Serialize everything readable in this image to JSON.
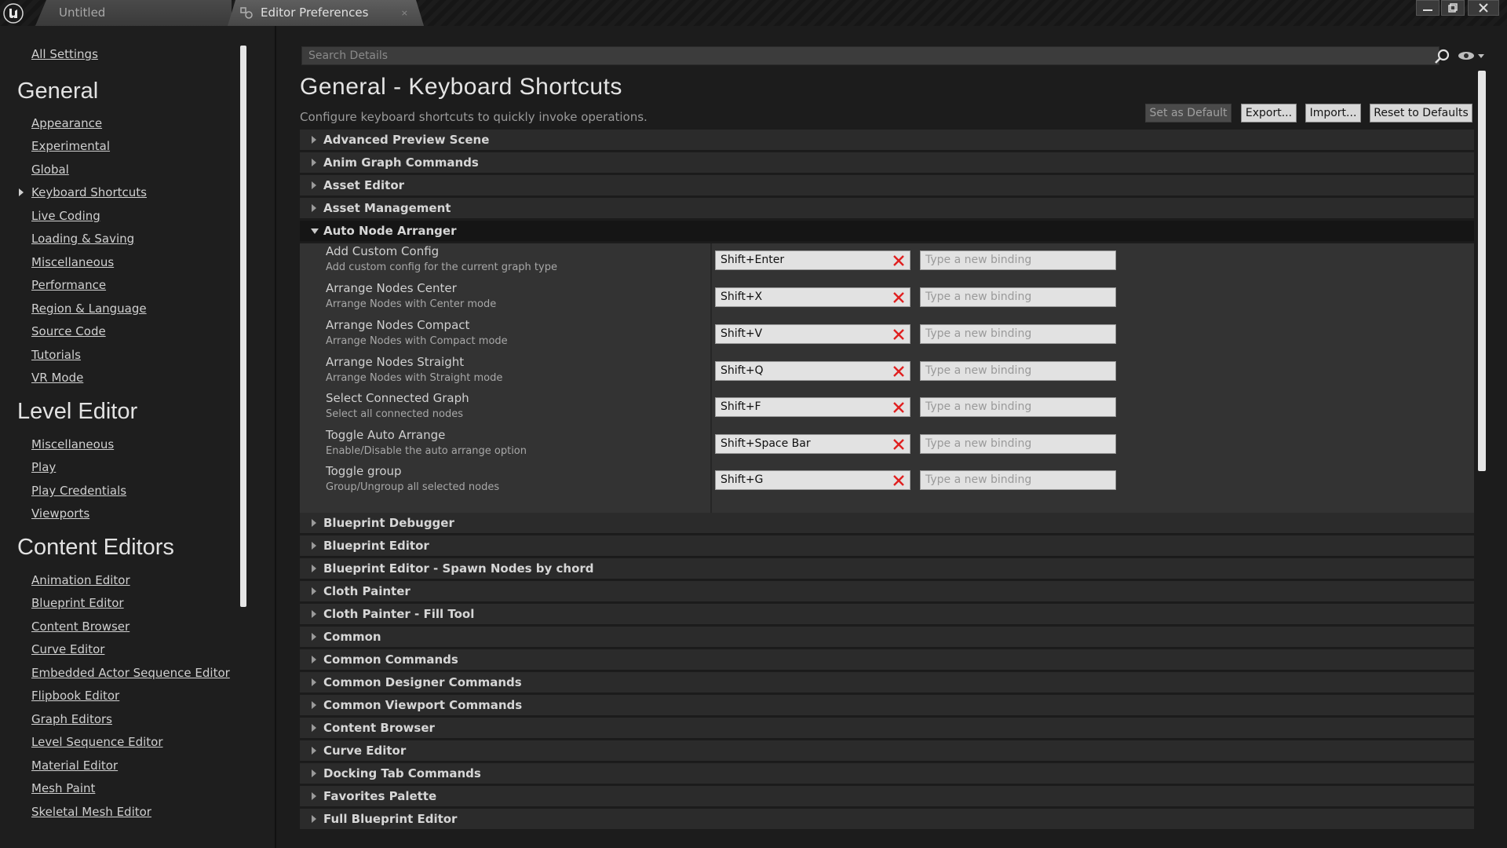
{
  "titlebar": {
    "tabs": [
      {
        "label": "Untitled"
      },
      {
        "label": "Editor Preferences"
      }
    ]
  },
  "sidebar": {
    "all_settings": "All Settings",
    "sections": [
      {
        "heading": "General",
        "items": [
          "Appearance",
          "Experimental",
          "Global",
          "Keyboard Shortcuts",
          "Live Coding",
          "Loading & Saving",
          "Miscellaneous",
          "Performance",
          "Region & Language",
          "Source Code",
          "Tutorials",
          "VR Mode"
        ]
      },
      {
        "heading": "Level Editor",
        "items": [
          "Miscellaneous",
          "Play",
          "Play Credentials",
          "Viewports"
        ]
      },
      {
        "heading": "Content Editors",
        "items": [
          "Animation Editor",
          "Blueprint Editor",
          "Content Browser",
          "Curve Editor",
          "Embedded Actor Sequence Editor",
          "Flipbook Editor",
          "Graph Editors",
          "Level Sequence Editor",
          "Material Editor",
          "Mesh Paint",
          "Skeletal Mesh Editor"
        ]
      }
    ],
    "active_item": "Keyboard Shortcuts"
  },
  "search": {
    "placeholder": "Search Details"
  },
  "page": {
    "title": "General - Keyboard Shortcuts",
    "description": "Configure keyboard shortcuts to quickly invoke operations."
  },
  "buttons": {
    "set_default": "Set as Default",
    "export": "Export...",
    "import": "Import...",
    "reset": "Reset to Defaults"
  },
  "categories_before": [
    "Advanced Preview Scene",
    "Anim Graph Commands",
    "Asset Editor",
    "Asset Management"
  ],
  "expanded_category": "Auto Node Arranger",
  "commands": [
    {
      "name": "Add Custom Config",
      "desc": "Add custom config for the current graph type",
      "binding": "Shift+Enter"
    },
    {
      "name": "Arrange Nodes Center",
      "desc": "Arrange Nodes with Center mode",
      "binding": "Shift+X"
    },
    {
      "name": "Arrange Nodes Compact",
      "desc": "Arrange Nodes with Compact mode",
      "binding": "Shift+V"
    },
    {
      "name": "Arrange Nodes Straight",
      "desc": "Arrange Nodes with Straight mode",
      "binding": "Shift+Q"
    },
    {
      "name": "Select Connected Graph",
      "desc": "Select all connected nodes",
      "binding": "Shift+F"
    },
    {
      "name": "Toggle Auto Arrange",
      "desc": "Enable/Disable the auto arrange option",
      "binding": "Shift+Space Bar"
    },
    {
      "name": "Toggle group",
      "desc": "Group/Ungroup all selected nodes",
      "binding": "Shift+G"
    }
  ],
  "new_binding_placeholder": "Type a new binding",
  "categories_after": [
    "Blueprint Debugger",
    "Blueprint Editor",
    "Blueprint Editor - Spawn Nodes by chord",
    "Cloth Painter",
    "Cloth Painter - Fill Tool",
    "Common",
    "Common Commands",
    "Common Designer Commands",
    "Common Viewport Commands",
    "Content Browser",
    "Curve Editor",
    "Docking Tab Commands",
    "Favorites Palette",
    "Full Blueprint Editor"
  ],
  "colors": {
    "clear_x": "#e02020",
    "background": "#1c1c1c"
  }
}
